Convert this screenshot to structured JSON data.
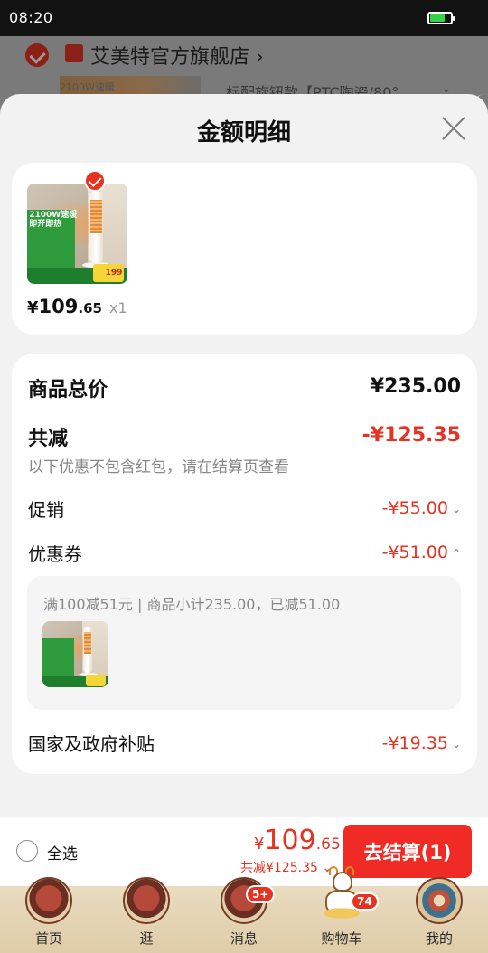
{
  "status_bar": {
    "time": "08:20",
    "battery_level": 0.7,
    "battery_color": "#37d14a"
  },
  "background": {
    "shop_name": "艾美特官方旗舰店",
    "shop_chevron": "›",
    "thumb_text": "2100W速暖",
    "product_title_partial": "标配旋钮款【PTC陶瓷/80°",
    "chevron": "⌄"
  },
  "sheet": {
    "title": "金额明细",
    "product": {
      "image_texts": [
        "2100W速暖",
        "即开即热"
      ],
      "image_price_chip": "199",
      "price_yen": "¥",
      "price_int": "109",
      "price_dec": ".65",
      "quantity": "x1"
    },
    "details": {
      "total_label": "商品总价",
      "total_value": "¥235.00",
      "discount_label": "共减",
      "discount_value": "-¥125.35",
      "discount_note": "以下优惠不包含红包，请在结算页查看",
      "promo_label": "促销",
      "promo_value": "-¥55.00",
      "coupon_label": "优惠券",
      "coupon_value": "-¥51.00",
      "coupon_detail": "满100减51元 | 商品小计235.00，已减51.00",
      "subsidy_label": "国家及政府补贴",
      "subsidy_value": "-¥19.35",
      "chevron_down": "⌄",
      "chevron_up": "⌃"
    }
  },
  "checkout": {
    "select_all_label": "全选",
    "price_yen": "¥",
    "price_int": "109",
    "price_dec": ".65",
    "discount_text": "共减¥125.35 ⌄",
    "button_label": "去结算(1)"
  },
  "tabbar": {
    "tabs": [
      {
        "label": "首页",
        "icon": "home-icon"
      },
      {
        "label": "逛",
        "icon": "browse-icon"
      },
      {
        "label": "消息",
        "icon": "message-icon",
        "badge": "5+"
      },
      {
        "label": "购物车",
        "icon": "cart-icon",
        "badge": "74"
      },
      {
        "label": "我的",
        "icon": "profile-icon"
      }
    ]
  },
  "colors": {
    "accent_red": "#e8311e",
    "button_red": "#f02a24",
    "tabbar_bg": "#e9dcc0"
  }
}
